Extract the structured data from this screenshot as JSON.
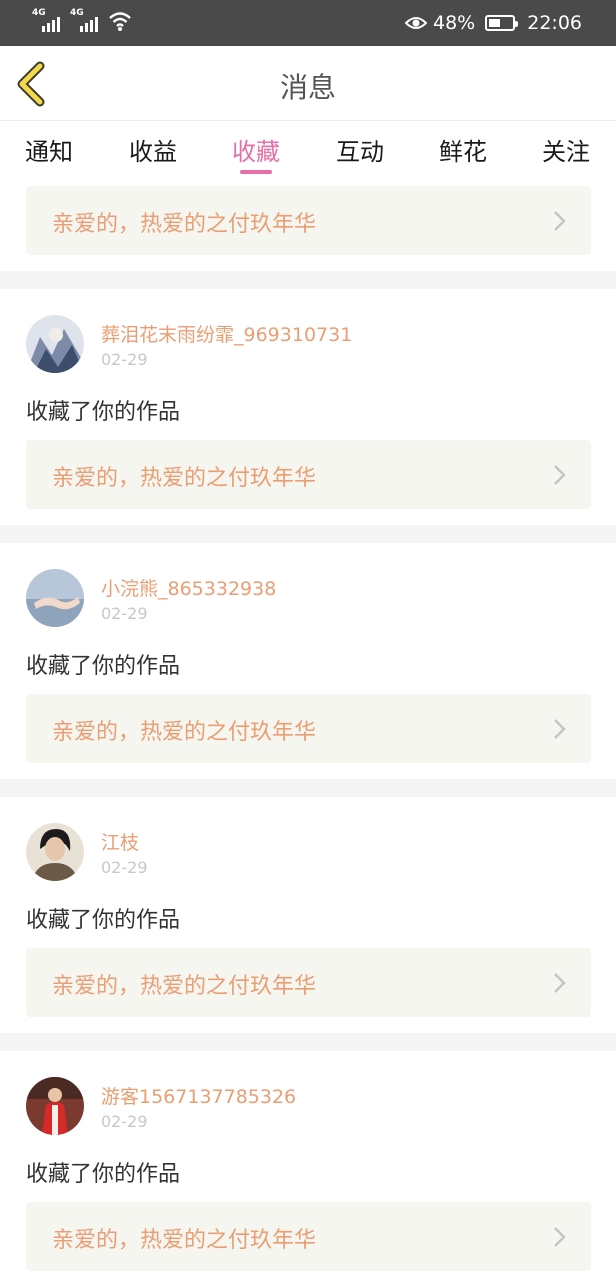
{
  "status_bar": {
    "signal1_label": "4G",
    "signal2_label": "4G",
    "battery_percent": "48%",
    "time": "22:06"
  },
  "header": {
    "title": "消息"
  },
  "tabs": [
    {
      "label": "通知"
    },
    {
      "label": "收益"
    },
    {
      "label": "收藏"
    },
    {
      "label": "互动"
    },
    {
      "label": "鲜花"
    },
    {
      "label": "关注"
    }
  ],
  "active_tab": "收藏",
  "top_partial_card": {
    "work_title": "亲爱的，热爱的之付玖年华"
  },
  "messages": [
    {
      "username": "葬泪花末雨纷霏_969310731",
      "date": "02-29",
      "action": "收藏了你的作品",
      "work_title": "亲爱的，热爱的之付玖年华"
    },
    {
      "username": "小浣熊_865332938",
      "date": "02-29",
      "action": "收藏了你的作品",
      "work_title": "亲爱的，热爱的之付玖年华"
    },
    {
      "username": "江枝",
      "date": "02-29",
      "action": "收藏了你的作品",
      "work_title": "亲爱的，热爱的之付玖年华"
    },
    {
      "username": "游客1567137785326",
      "date": "02-29",
      "action": "收藏了你的作品",
      "work_title": "亲爱的，热爱的之付玖年华"
    }
  ],
  "colors": {
    "accent_pink": "#e86ea8",
    "accent_orange": "#ea9e74",
    "back_arrow_yellow": "#f2d84a",
    "status_bar_bg": "#4a4a4a"
  }
}
